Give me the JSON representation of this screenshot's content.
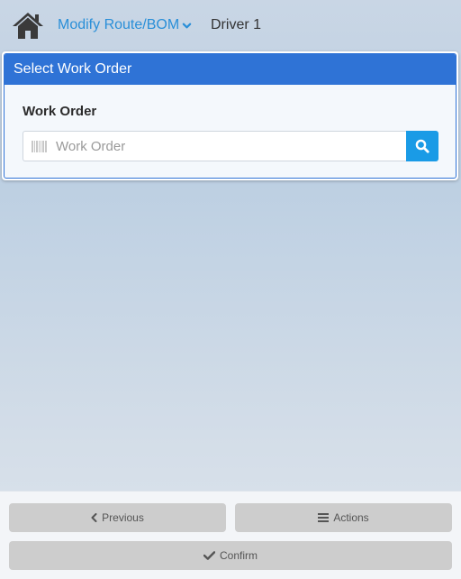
{
  "header": {
    "nav_title": "Modify Route/BOM",
    "driver": "Driver 1"
  },
  "card": {
    "title": "Select Work Order",
    "field_label": "Work Order",
    "input_placeholder": "Work Order",
    "input_value": ""
  },
  "footer": {
    "previous_label": "Previous",
    "actions_label": "Actions",
    "confirm_label": "Confirm"
  },
  "colors": {
    "accent_blue": "#2f73d6",
    "link_blue": "#2a8fd8",
    "search_button": "#1a9be6"
  },
  "icons": [
    "home-icon",
    "chevron-down-icon",
    "barcode-icon",
    "search-icon",
    "chevron-left-icon",
    "menu-icon",
    "check-icon"
  ]
}
